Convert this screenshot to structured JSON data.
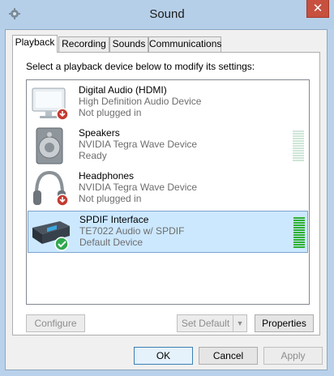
{
  "window": {
    "title": "Sound",
    "icon": "sound-settings-icon"
  },
  "tabs": [
    {
      "label": "Playback",
      "active": true
    },
    {
      "label": "Recording",
      "active": false
    },
    {
      "label": "Sounds",
      "active": false
    },
    {
      "label": "Communications",
      "active": false
    }
  ],
  "instruction": "Select a playback device below to modify its settings:",
  "devices": [
    {
      "name": "Digital Audio (HDMI)",
      "driver": "High Definition Audio Device",
      "status": "Not plugged in",
      "icon": "monitor-icon",
      "badge": "unplugged-badge-icon"
    },
    {
      "name": "Speakers",
      "driver": "NVIDIA Tegra Wave Device",
      "status": "Ready",
      "icon": "speaker-icon",
      "level": 0
    },
    {
      "name": "Headphones",
      "driver": "NVIDIA Tegra Wave Device",
      "status": "Not plugged in",
      "icon": "headphones-icon",
      "badge": "unplugged-badge-icon"
    },
    {
      "name": "SPDIF Interface",
      "driver": "TE7022 Audio w/ SPDIF",
      "status": "Default Device",
      "icon": "spdif-device-icon",
      "badge": "default-check-badge-icon",
      "selected": true,
      "level": 1
    }
  ],
  "buttons": {
    "configure": "Configure",
    "set_default": "Set Default",
    "properties": "Properties",
    "ok": "OK",
    "cancel": "Cancel",
    "apply": "Apply"
  },
  "colors": {
    "selection": "#cce8ff",
    "level_active": "#2fb12f",
    "level_idle": "#cfe6d8",
    "close_button": "#c7503e"
  }
}
